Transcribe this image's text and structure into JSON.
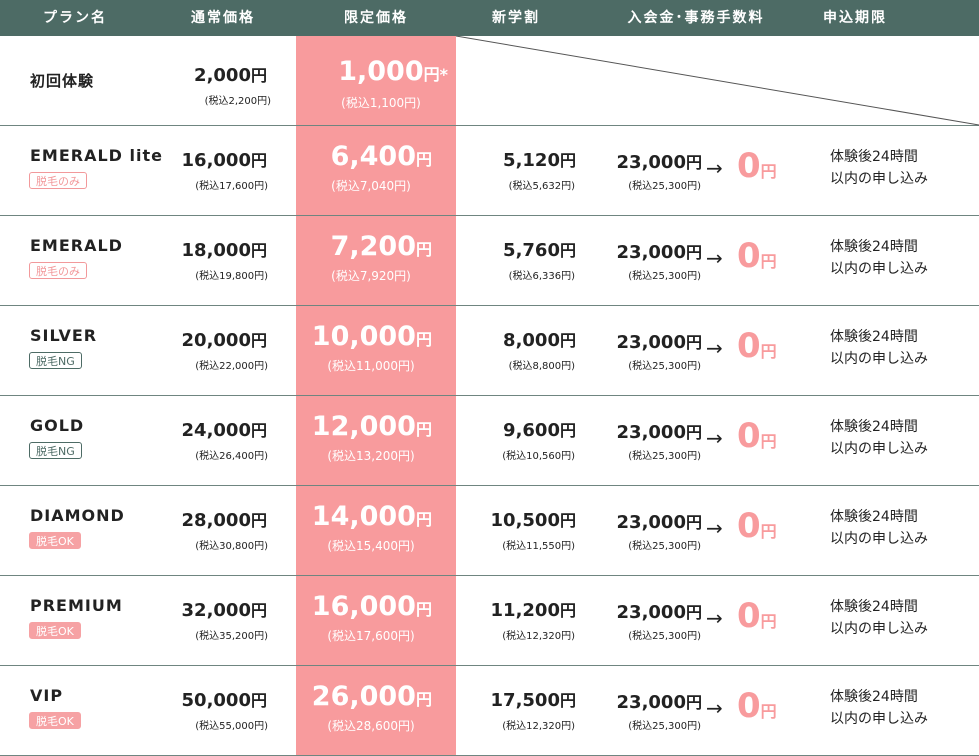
{
  "header": {
    "plan": "プラン名",
    "normal": "通常価格",
    "limited": "限定価格",
    "student": "新学割",
    "fee": "入会金･事務手数料",
    "deadline": "申込期限"
  },
  "trial": {
    "name": "初回体験",
    "normal": "2,000",
    "normal_tax": "(税込2,200円)",
    "limited": "1,000",
    "limited_suffix": "円*",
    "limited_tax": "(税込1,100円)"
  },
  "yen": "円",
  "arrow": "→",
  "fee_after": "0",
  "plans": [
    {
      "name": "EMERALD lite",
      "badge": "脱毛のみ",
      "badge_style": "pink-outline",
      "normal": "16,000",
      "normal_tax": "(税込17,600円)",
      "limited": "6,400",
      "limited_tax": "(税込7,040円)",
      "student": "5,120",
      "student_tax": "(税込5,632円)",
      "fee": "23,000",
      "fee_tax": "(税込25,300円)",
      "deadline1": "体験後24時間",
      "deadline2": "以内の申し込み"
    },
    {
      "name": "EMERALD",
      "badge": "脱毛のみ",
      "badge_style": "pink-outline",
      "normal": "18,000",
      "normal_tax": "(税込19,800円)",
      "limited": "7,200",
      "limited_tax": "(税込7,920円)",
      "student": "5,760",
      "student_tax": "(税込6,336円)",
      "fee": "23,000",
      "fee_tax": "(税込25,300円)",
      "deadline1": "体験後24時間",
      "deadline2": "以内の申し込み"
    },
    {
      "name": "SILVER",
      "badge": "脱毛NG",
      "badge_style": "green-outline",
      "normal": "20,000",
      "normal_tax": "(税込22,000円)",
      "limited": "10,000",
      "limited_tax": "(税込11,000円)",
      "student": "8,000",
      "student_tax": "(税込8,800円)",
      "fee": "23,000",
      "fee_tax": "(税込25,300円)",
      "deadline1": "体験後24時間",
      "deadline2": "以内の申し込み"
    },
    {
      "name": "GOLD",
      "badge": "脱毛NG",
      "badge_style": "green-outline",
      "normal": "24,000",
      "normal_tax": "(税込26,400円)",
      "limited": "12,000",
      "limited_tax": "(税込13,200円)",
      "student": "9,600",
      "student_tax": "(税込10,560円)",
      "fee": "23,000",
      "fee_tax": "(税込25,300円)",
      "deadline1": "体験後24時間",
      "deadline2": "以内の申し込み"
    },
    {
      "name": "DIAMOND",
      "badge": "脱毛OK",
      "badge_style": "pink-fill",
      "normal": "28,000",
      "normal_tax": "(税込30,800円)",
      "limited": "14,000",
      "limited_tax": "(税込15,400円)",
      "student": "10,500",
      "student_tax": "(税込11,550円)",
      "fee": "23,000",
      "fee_tax": "(税込25,300円)",
      "deadline1": "体験後24時間",
      "deadline2": "以内の申し込み"
    },
    {
      "name": "PREMIUM",
      "badge": "脱毛OK",
      "badge_style": "pink-fill",
      "normal": "32,000",
      "normal_tax": "(税込35,200円)",
      "limited": "16,000",
      "limited_tax": "(税込17,600円)",
      "student": "11,200",
      "student_tax": "(税込12,320円)",
      "fee": "23,000",
      "fee_tax": "(税込25,300円)",
      "deadline1": "体験後24時間",
      "deadline2": "以内の申し込み"
    },
    {
      "name": "VIP",
      "badge": "脱毛OK",
      "badge_style": "pink-fill",
      "normal": "50,000",
      "normal_tax": "(税込55,000円)",
      "limited": "26,000",
      "limited_tax": "(税込28,600円)",
      "student": "17,500",
      "student_tax": "(税込12,320円)",
      "fee": "23,000",
      "fee_tax": "(税込25,300円)",
      "deadline1": "体験後24時間",
      "deadline2": "以内の申し込み"
    }
  ],
  "colors": {
    "header_bg": "#4d6b65",
    "accent_pink": "#f89b9d",
    "divider": "#6f8580"
  }
}
